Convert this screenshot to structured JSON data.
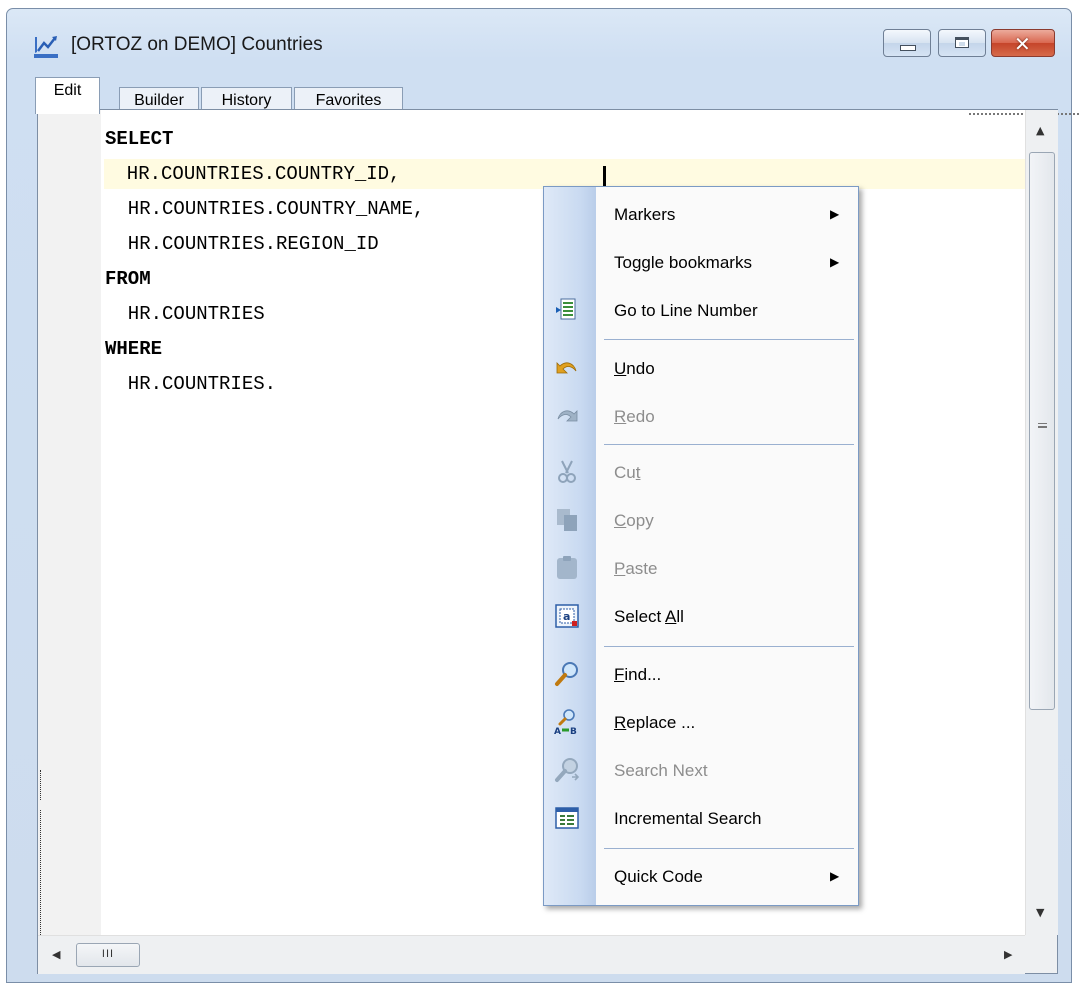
{
  "window": {
    "title": "[ORTOZ on DEMO] Countries",
    "close_glyph": "✕"
  },
  "tabs": [
    {
      "label": "Edit",
      "active": true
    },
    {
      "label": "Builder",
      "active": false
    },
    {
      "label": "History",
      "active": false
    },
    {
      "label": "Favorites",
      "active": false
    }
  ],
  "editor": {
    "lines": [
      "SELECT",
      "  HR.COUNTRIES.COUNTRY_ID,",
      "  HR.COUNTRIES.COUNTRY_NAME,",
      "  HR.COUNTRIES.REGION_ID",
      "FROM",
      "  HR.COUNTRIES",
      "WHERE",
      "  HR.COUNTRIES."
    ],
    "current_line": 2
  },
  "scrollbars": {
    "up_arrow": "▲",
    "down_arrow": "▼",
    "left_arrow": "◀",
    "right_arrow": "▶",
    "h_thumb_grip": "III"
  },
  "context_menu": {
    "items": [
      {
        "label": "Markers",
        "icon": "none",
        "submenu": true,
        "enabled": true
      },
      {
        "label": "Toggle bookmarks",
        "icon": "none",
        "submenu": true,
        "enabled": true
      },
      {
        "label": "Go to Line Number",
        "icon": "goto-line-icon",
        "submenu": false,
        "enabled": true
      },
      {
        "label": "Undo",
        "icon": "undo-icon",
        "submenu": false,
        "enabled": true
      },
      {
        "label": "Redo",
        "icon": "redo-icon",
        "submenu": false,
        "enabled": false
      },
      {
        "label": "Cut",
        "icon": "cut-icon",
        "submenu": false,
        "enabled": false
      },
      {
        "label": "Copy",
        "icon": "copy-icon",
        "submenu": false,
        "enabled": false
      },
      {
        "label": "Paste",
        "icon": "paste-icon",
        "submenu": false,
        "enabled": false
      },
      {
        "label": "Select All",
        "icon": "select-all-icon",
        "submenu": false,
        "enabled": true
      },
      {
        "label": "Find...",
        "icon": "find-icon",
        "submenu": false,
        "enabled": true
      },
      {
        "label": "Replace ...",
        "icon": "replace-icon",
        "submenu": false,
        "enabled": true
      },
      {
        "label": "Search Next",
        "icon": "search-next-icon",
        "submenu": false,
        "enabled": false
      },
      {
        "label": "Incremental Search",
        "icon": "incremental-search-icon",
        "submenu": false,
        "enabled": true
      },
      {
        "label": "Quick Code",
        "icon": "none",
        "submenu": true,
        "enabled": true
      }
    ],
    "submenu_arrow": "▶"
  },
  "colors": {
    "current_line_bg": "#fffbe1",
    "menu_border": "#7b9ac4",
    "disabled_text": "#8d8d8d"
  }
}
